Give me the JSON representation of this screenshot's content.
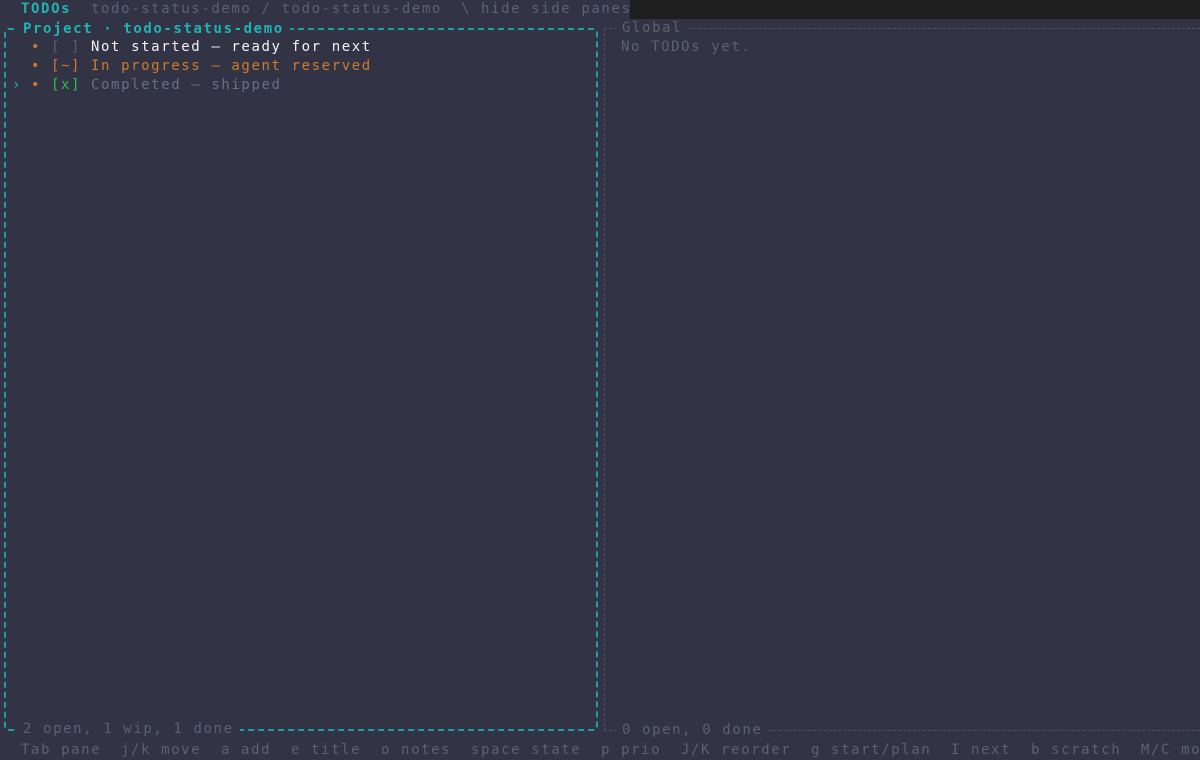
{
  "titlebar": {
    "title": "TODOs",
    "breadcrumb": "todo-status-demo / todo-status-demo",
    "hide_panes": "\\ hide side panes"
  },
  "project_pane": {
    "title": "Project · todo-status-demo",
    "footer": "2 open, 1 wip, 1 done",
    "items": [
      {
        "cursor": "",
        "bullet": "•",
        "box": "[ ]",
        "title": "Not started — ready for next",
        "state": "open"
      },
      {
        "cursor": "",
        "bullet": "•",
        "box": "[~]",
        "title": "In progress — agent reserved",
        "state": "wip"
      },
      {
        "cursor": "›",
        "bullet": "•",
        "box": "[x]",
        "title": "Completed — shipped",
        "state": "done"
      }
    ]
  },
  "global_pane": {
    "title": "Global",
    "empty_message": "No TODOs yet.",
    "footer": "0 open, 0 done"
  },
  "help": [
    "Tab pane",
    "j/k move",
    "a add",
    "e title",
    "o notes",
    "space state",
    "p prio",
    "J/K reorder",
    "g start/plan",
    "I next",
    "b scratch",
    "M/C mo"
  ],
  "colors": {
    "background": "#323446",
    "accent": "#1fb3b3",
    "wip": "#d07a2a",
    "done": "#2fbf4a",
    "muted": "#5d6072"
  }
}
